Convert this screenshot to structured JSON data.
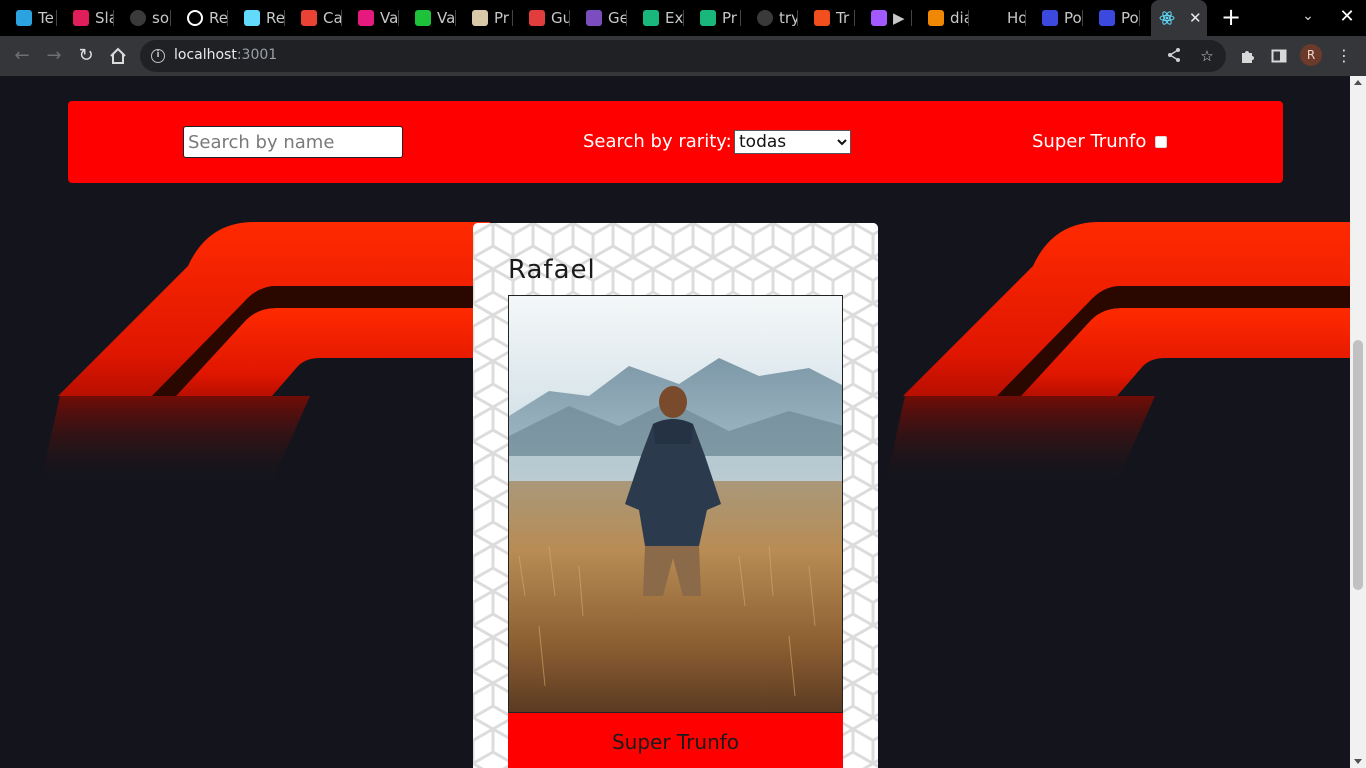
{
  "browser": {
    "tabs": [
      {
        "title": "Te",
        "icon": "telegram-icon",
        "color": "#2aa3e0"
      },
      {
        "title": "Sla",
        "icon": "slack-icon",
        "color": "#e01e5a"
      },
      {
        "title": "sol",
        "icon": "github-icon",
        "color": "#3a3a3a"
      },
      {
        "title": "Re",
        "icon": "globe-icon",
        "color": "#ffffff"
      },
      {
        "title": "Re",
        "icon": "react-icon",
        "color": "#61dafb"
      },
      {
        "title": "Ca",
        "icon": "gmail-icon",
        "color": "#ea4335"
      },
      {
        "title": "Va",
        "icon": "chevron-brand-icon",
        "color": "#e5197e"
      },
      {
        "title": "Va",
        "icon": "phone-icon",
        "color": "#1ec13a"
      },
      {
        "title": "Pr",
        "icon": "hammer-icon",
        "color": "#d9c9a8"
      },
      {
        "title": "Gu",
        "icon": "bug-icon",
        "color": "#e13d3d"
      },
      {
        "title": "Ge",
        "icon": "glasses-icon",
        "color": "#7c4dbf"
      },
      {
        "title": "Ex",
        "icon": "box-icon",
        "color": "#19b77c"
      },
      {
        "title": "Pr",
        "icon": "box-icon",
        "color": "#19b77c"
      },
      {
        "title": "try",
        "icon": "github-icon",
        "color": "#3a3a3a"
      },
      {
        "title": "Tr",
        "icon": "figma-icon",
        "color": "#f24e1e"
      },
      {
        "title": "▶",
        "icon": "figma-icon",
        "color": "#a259ff"
      },
      {
        "title": "dia",
        "icon": "diagram-icon",
        "color": "#f08705"
      },
      {
        "title": "Ho",
        "icon": "blank-icon",
        "color": "#000000"
      },
      {
        "title": "Po",
        "icon": "dev-icon",
        "color": "#3b49df"
      },
      {
        "title": "Po",
        "icon": "dev-icon",
        "color": "#3b49df"
      }
    ],
    "active_tab": {
      "icon": "react-icon",
      "close": "✕"
    },
    "new_tab": "+",
    "url_host": "localhost",
    "url_port": ":3001",
    "profile_initial": "R"
  },
  "filters": {
    "name_placeholder": "Search by name",
    "rarity_label": "Search by rarity:",
    "rarity_selected": "todas",
    "trunfo_label": "Super Trunfo"
  },
  "card": {
    "name": "Rafael",
    "image_alt": "man standing in a wheat field facing mountains",
    "trunfo_text": "Super Trunfo"
  },
  "colors": {
    "page_bg": "#14151c",
    "accent_red": "#ff0000",
    "logo_red": "#ee1a00"
  }
}
